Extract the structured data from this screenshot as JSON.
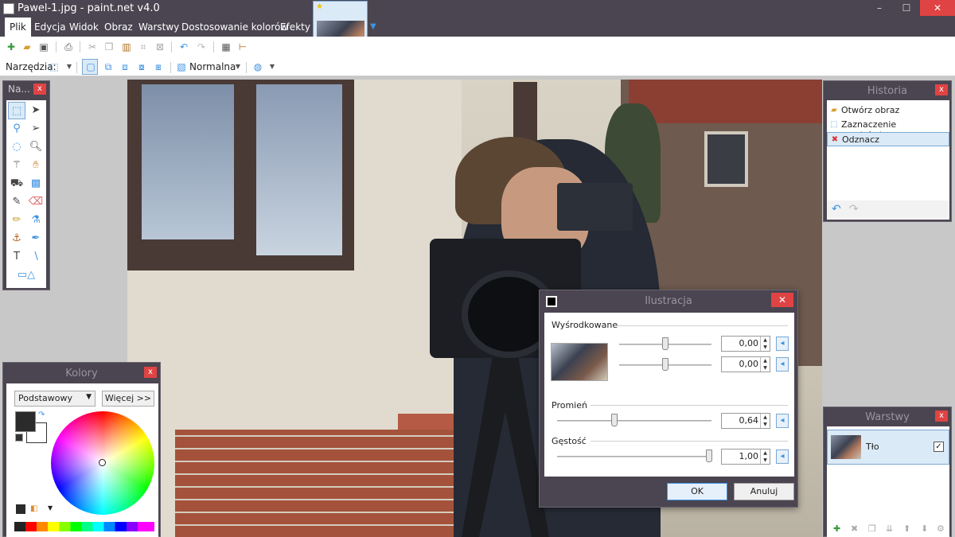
{
  "window": {
    "title": "Pawel-1.jpg - paint.net v4.0",
    "controls": [
      "–",
      "☐",
      "✕"
    ]
  },
  "menu": {
    "items": [
      "Plik",
      "Edycja",
      "Widok",
      "Obraz",
      "Warstwy",
      "Dostosowanie kolorów",
      "Efekty"
    ]
  },
  "toolbar2": {
    "tools_label": "Narzędzia:",
    "blend_mode": "Normalna"
  },
  "tools_panel": {
    "title": "Na...",
    "close": "x"
  },
  "colors_panel": {
    "title": "Kolory",
    "close": "x",
    "palette_select": "Podstawowy",
    "more_button": "Więcej >>",
    "primary_color": "#2b2b2b",
    "secondary_color": "#ffffff"
  },
  "history_panel": {
    "title": "Historia",
    "close": "x",
    "items": [
      "Otwórz obraz",
      "Zaznaczenie prostokątne",
      "Odznacz"
    ],
    "selected_index": 2
  },
  "layers_panel": {
    "title": "Warstwy",
    "close": "x",
    "layer_name": "Tło",
    "layer_visible": true
  },
  "dialog": {
    "title": "Ilustracja",
    "close": "✕",
    "centered_label": "Wyśrodkowane",
    "center_x": "0,00",
    "center_y": "0,00",
    "radius_label": "Promień",
    "radius_value": "0,64",
    "density_label": "Gęstość",
    "density_value": "1,00",
    "ok": "OK",
    "cancel": "Anuluj"
  }
}
